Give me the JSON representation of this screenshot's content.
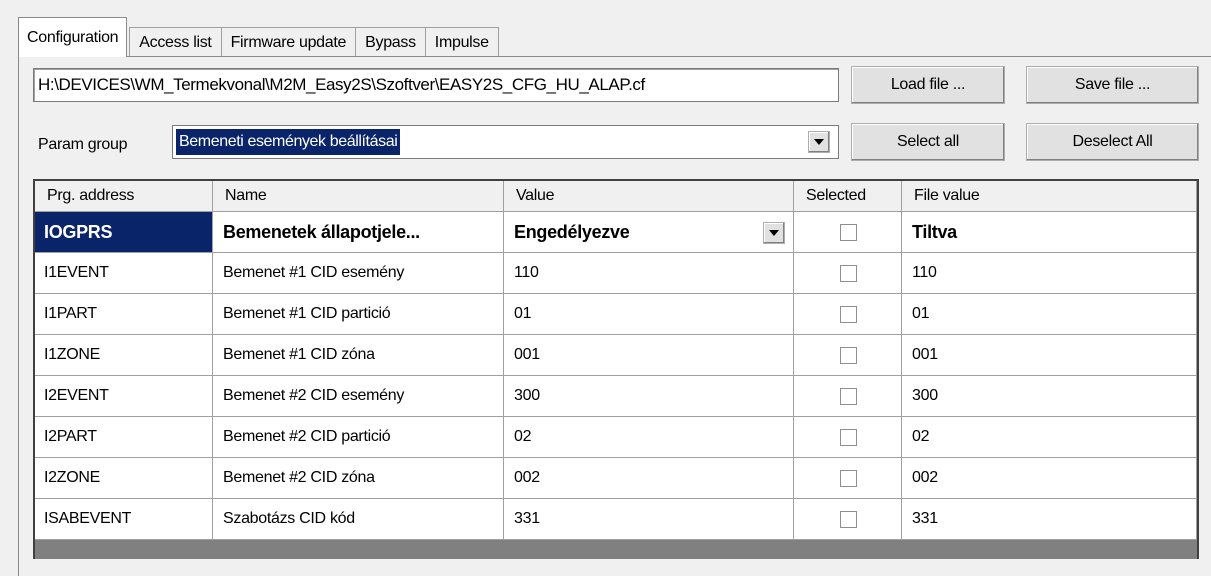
{
  "tabs": [
    {
      "label": "Configuration",
      "active": true
    },
    {
      "label": "Access list",
      "active": false
    },
    {
      "label": "Firmware update",
      "active": false
    },
    {
      "label": "Bypass",
      "active": false
    },
    {
      "label": "Impulse",
      "active": false
    }
  ],
  "file": {
    "path": "H:\\DEVICES\\WM_Termekvonal\\M2M_Easy2S\\Szoftver\\EASY2S_CFG_HU_ALAP.cf",
    "load_label": "Load file ...",
    "save_label": "Save file ..."
  },
  "param_group": {
    "label": "Param group",
    "selected": "Bemeneti események beállításai",
    "select_all_label": "Select all",
    "deselect_all_label": "Deselect All"
  },
  "grid": {
    "headers": [
      "Prg. address",
      "Name",
      "Value",
      "Selected",
      "File value"
    ],
    "rows": [
      {
        "address": "IOGPRS",
        "name": "Bemenetek állapotjele...",
        "value": "Engedélyezve",
        "selected": false,
        "file_value": "Tiltva"
      },
      {
        "address": "I1EVENT",
        "name": "Bemenet #1 CID esemény",
        "value": "110",
        "selected": false,
        "file_value": "110"
      },
      {
        "address": "I1PART",
        "name": "Bemenet #1 CID partició",
        "value": "01",
        "selected": false,
        "file_value": "01"
      },
      {
        "address": "I1ZONE",
        "name": "Bemenet #1 CID zóna",
        "value": "001",
        "selected": false,
        "file_value": "001"
      },
      {
        "address": "I2EVENT",
        "name": "Bemenet #2 CID esemény",
        "value": "300",
        "selected": false,
        "file_value": "300"
      },
      {
        "address": "I2PART",
        "name": "Bemenet #2 CID partició",
        "value": "02",
        "selected": false,
        "file_value": "02"
      },
      {
        "address": "I2ZONE",
        "name": "Bemenet #2 CID zóna",
        "value": "002",
        "selected": false,
        "file_value": "002"
      },
      {
        "address": "ISABEVENT",
        "name": "Szabotázs CID kód",
        "value": "331",
        "selected": false,
        "file_value": "331"
      }
    ]
  },
  "icons": {
    "dropdown": "chevron-down-icon",
    "checkbox": "checkbox-icon"
  },
  "colors": {
    "selection": "#0a246a",
    "background": "#f0f0f0"
  }
}
